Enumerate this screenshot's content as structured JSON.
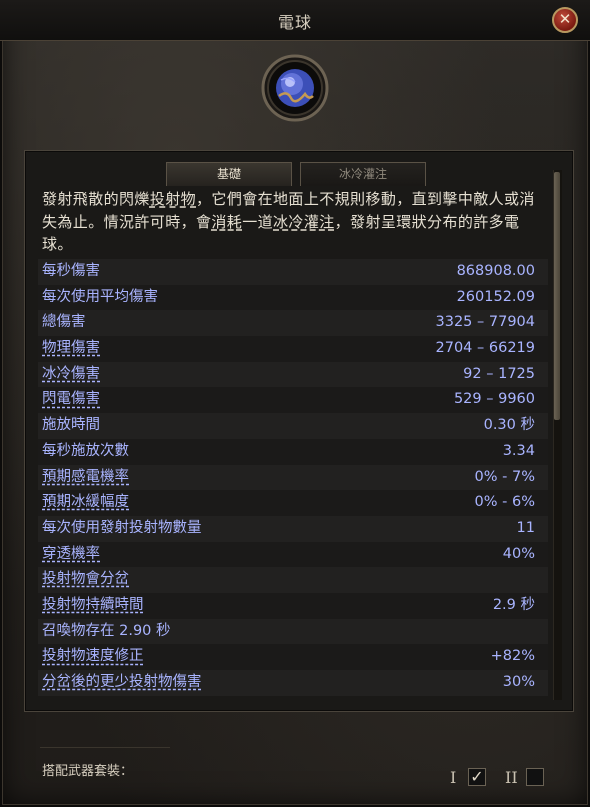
{
  "window": {
    "title": "電球",
    "close_symbol": "✕"
  },
  "skill_icon": "electric-orb-icon",
  "tabs": [
    {
      "label": "基礎",
      "active": true
    },
    {
      "label": "冰冷灌注",
      "active": false
    }
  ],
  "description": {
    "p1": "發射飛散的閃爍",
    "k1": "投射物",
    "p2": "，它們會在地面上不規則移動，直到擊中敵人或消失為止。情況許可時，會",
    "k2": "消耗",
    "p3": "一道",
    "k3": "冰冷灌注",
    "p4": "，發射呈環狀分布的許多電球。"
  },
  "stats": [
    {
      "label": "每秒傷害",
      "value": "868908.00"
    },
    {
      "label": "每次使用平均傷害",
      "value": "260152.09"
    },
    {
      "label": "總傷害",
      "value": "3325 – 77904"
    },
    {
      "label": "物理傷害",
      "value": "2704 – 66219"
    },
    {
      "label": "冰冷傷害",
      "value": "92 – 1725"
    },
    {
      "label": "閃電傷害",
      "value": "529 – 9960"
    },
    {
      "label": "施放時間",
      "value": "0.30 秒"
    },
    {
      "label": "每秒施放次數",
      "value": "3.34"
    },
    {
      "label": "預期感電機率",
      "value": "0% - 7%"
    },
    {
      "label": "預期冰緩幅度",
      "value": "0% - 6%"
    },
    {
      "label": "每次使用發射投射物數量",
      "value": "11"
    },
    {
      "label": "穿透機率",
      "value": "40%"
    },
    {
      "label": "投射物會分岔",
      "value": ""
    },
    {
      "label": "投射物持續時間",
      "value": "2.9 秒"
    },
    {
      "label": "召喚物存在 2.90 秒",
      "value": ""
    },
    {
      "label": "投射物速度修正",
      "value": "+82%"
    },
    {
      "label": "分岔後的更少投射物傷害",
      "value": "30%"
    }
  ],
  "footer": {
    "weapon_set_label": "搭配武器套裝：",
    "set1": {
      "label": "I",
      "checked": true,
      "check_symbol": "✓"
    },
    "set2": {
      "label": "II",
      "checked": false
    }
  }
}
